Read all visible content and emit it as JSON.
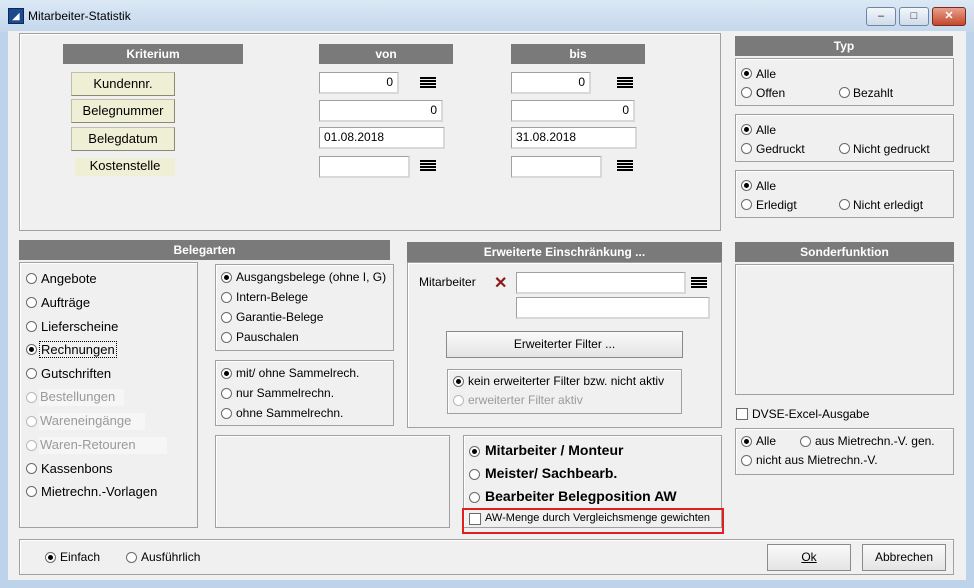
{
  "window": {
    "title": "Mitarbeiter-Statistik",
    "app_icon": "app-icon",
    "minimize": "–",
    "maximize": "□",
    "close": "✕"
  },
  "criteria": {
    "headers": {
      "kriterium": "Kriterium",
      "von": "von",
      "bis": "bis"
    },
    "rows": [
      {
        "label": "Kundennr.",
        "von": "0",
        "bis": "0"
      },
      {
        "label": "Belegnummer",
        "von": "0",
        "bis": "0"
      },
      {
        "label": "Belegdatum",
        "von": "01.08.2018",
        "bis": "31.08.2018"
      },
      {
        "label": "Kostenstelle",
        "von": "",
        "bis": ""
      }
    ]
  },
  "typ": {
    "header": "Typ",
    "group1": {
      "alle": "Alle",
      "offen": "Offen",
      "bezahlt": "Bezahlt",
      "selected": "Alle"
    },
    "group2": {
      "alle": "Alle",
      "gedruckt": "Gedruckt",
      "nicht": "Nicht gedruckt",
      "selected": "Alle"
    },
    "group3": {
      "alle": "Alle",
      "erledigt": "Erledigt",
      "nicht": "Nicht erledigt",
      "selected": "Alle"
    }
  },
  "belegarten": {
    "header": "Belegarten",
    "items": [
      {
        "label": "Angebote",
        "selected": false,
        "disabled": false
      },
      {
        "label": "Aufträge",
        "selected": false,
        "disabled": false
      },
      {
        "label": "Lieferscheine",
        "selected": false,
        "disabled": false
      },
      {
        "label": "Rechnungen",
        "selected": true,
        "disabled": false
      },
      {
        "label": "Gutschriften",
        "selected": false,
        "disabled": false
      },
      {
        "label": "Bestellungen",
        "selected": false,
        "disabled": true
      },
      {
        "label": "Wareneingänge",
        "selected": false,
        "disabled": true
      },
      {
        "label": "Waren-Retouren",
        "selected": false,
        "disabled": true
      },
      {
        "label": "Kassenbons",
        "selected": false,
        "disabled": false
      },
      {
        "label": "Mietrechn.-Vorlagen",
        "selected": false,
        "disabled": false
      }
    ],
    "ausgang": [
      "Ausgangsbelege (ohne I, G)",
      "Intern-Belege",
      "Garantie-Belege",
      "Pauschalen"
    ],
    "sammel": [
      "mit/ ohne Sammelrech.",
      "nur Sammelrechn.",
      "ohne Sammelrechn."
    ]
  },
  "erweitert": {
    "header": "Erweiterte Einschränkung ...",
    "mitarbeiter_label": "Mitarbeiter",
    "filter_button": "Erweiterter Filter ...",
    "filter_off": "kein erweiterter Filter bzw. nicht aktiv",
    "filter_on": "erweiterter Filter aktiv"
  },
  "sonder": {
    "header": "Sonderfunktion"
  },
  "dvse": {
    "label": "DVSE-Excel-Ausgabe"
  },
  "mietrechn": {
    "alle": "Alle",
    "aus": "aus Mietrechn.-V. gen.",
    "nicht_aus": "nicht aus Mietrechn.-V."
  },
  "gruppierung": {
    "options": [
      "Mitarbeiter / Monteur",
      "Meister/ Sachbearb.",
      "Bearbeiter Belegposition AW"
    ],
    "aw_menge": "AW-Menge durch Vergleichsmenge gewichten"
  },
  "bottom": {
    "einfach": "Einfach",
    "ausfuehrlich": "Ausführlich",
    "ok": "Ok",
    "abbrechen": "Abbrechen"
  },
  "colors": {
    "header_bg": "#7a7a7a",
    "criteria_btn": "#efefd6",
    "highlight": "#e02020",
    "delete_x": "#8b1a1a"
  }
}
